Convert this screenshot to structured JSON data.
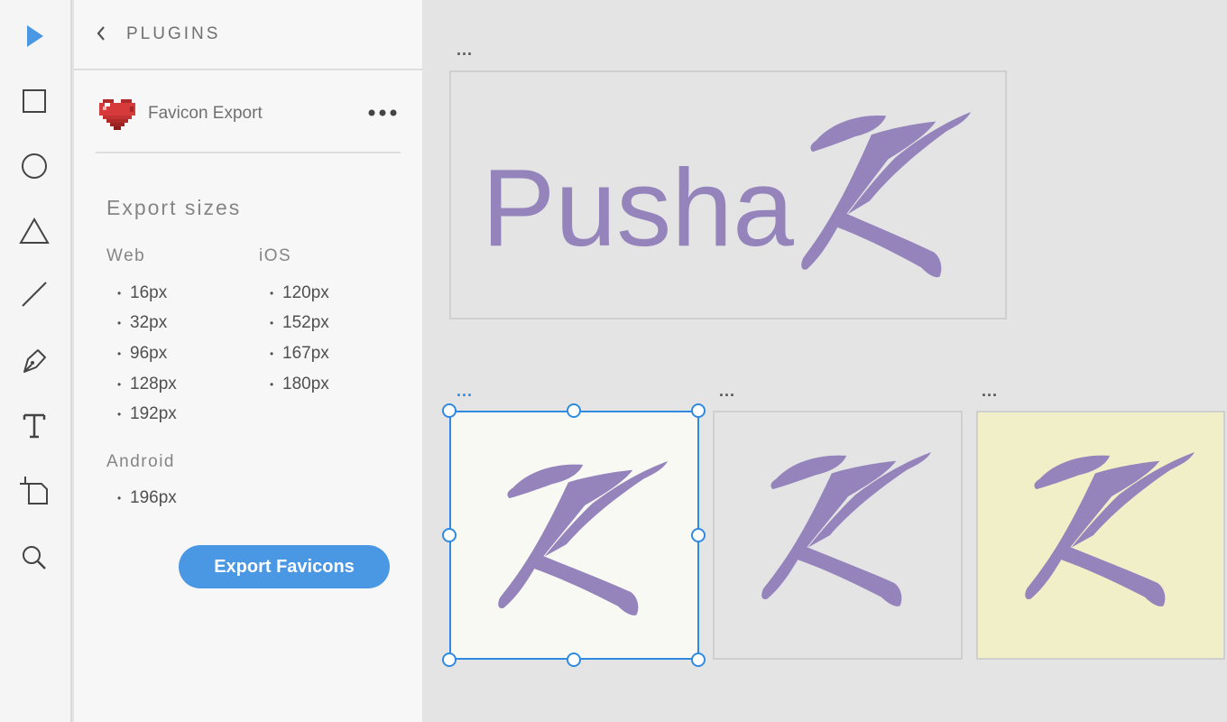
{
  "toolbar": {
    "tools": [
      {
        "name": "select-tool",
        "icon": "arrow-pointer-icon",
        "active": true
      },
      {
        "name": "rectangle-tool",
        "icon": "rectangle-icon"
      },
      {
        "name": "ellipse-tool",
        "icon": "ellipse-icon"
      },
      {
        "name": "polygon-tool",
        "icon": "triangle-icon"
      },
      {
        "name": "line-tool",
        "icon": "line-icon"
      },
      {
        "name": "pen-tool",
        "icon": "pen-nib-icon"
      },
      {
        "name": "text-tool",
        "icon": "text-t-icon"
      },
      {
        "name": "artboard-tool",
        "icon": "artboard-icon"
      },
      {
        "name": "zoom-tool",
        "icon": "magnifier-icon"
      }
    ],
    "active_color": "#4a97e4"
  },
  "panel": {
    "title": "PLUGINS",
    "plugin": {
      "name": "Favicon Export",
      "icon": "pixel-heart-icon",
      "more_label": "•••"
    },
    "export_sizes": {
      "title": "Export sizes",
      "web": {
        "label": "Web",
        "sizes": [
          "16px",
          "32px",
          "96px",
          "128px",
          "192px"
        ]
      },
      "ios": {
        "label": "iOS",
        "sizes": [
          "120px",
          "152px",
          "167px",
          "180px"
        ]
      },
      "android": {
        "label": "Android",
        "sizes": [
          "196px"
        ]
      }
    },
    "export_button": {
      "label": "Export Favicons",
      "color": "#4a97e4"
    }
  },
  "canvas": {
    "artboards": [
      {
        "menu": "...",
        "logo_text": "Pusha",
        "background": "#e4e4e4",
        "selected": false
      },
      {
        "menu": "...",
        "background": "#f9f9f4",
        "selected": true
      },
      {
        "menu": "...",
        "background": "#e4e4e4",
        "selected": false
      },
      {
        "menu": "...",
        "background": "#f1efc8",
        "selected": false
      }
    ],
    "logo_color": "#9584bc",
    "selection_color": "#2f8ae0"
  }
}
